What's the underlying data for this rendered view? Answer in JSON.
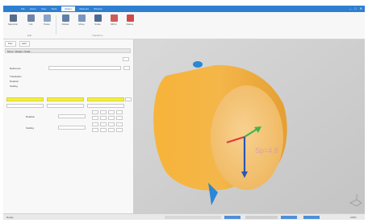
{
  "title_tabs": [
    "File",
    "Home",
    "View",
    "Tools",
    "Model",
    "Measure",
    "Window"
  ],
  "active_tab": "Model",
  "window_controls": {
    "minimize": "–",
    "maximize": "□",
    "close": "✕"
  },
  "ribbon": {
    "buttons": [
      {
        "label": "Selection",
        "color": "#5a6c8c"
      },
      {
        "label": "Cut",
        "color": "#6f84a8"
      },
      {
        "label": "Paste",
        "color": "#8aa4c8"
      },
      {
        "label": "Rotate",
        "color": "#5f7fa8"
      },
      {
        "label": "Move",
        "color": "#7a96be"
      },
      {
        "label": "Scale",
        "color": "#4d6a96"
      },
      {
        "label": "Mirror",
        "color": "#cf5b5b"
      },
      {
        "label": "Delete",
        "color": "#d04a4a"
      }
    ],
    "groups": [
      "Edit",
      "Transform"
    ]
  },
  "panel": {
    "tabs": [
      "Part",
      "Edit"
    ],
    "section_title": "Move / Rotate / Scale",
    "rows": [
      {
        "label": "Reference"
      },
      {
        "label": "Translation"
      },
      {
        "label": "Rotation"
      },
      {
        "label": "Scaling"
      }
    ],
    "sub_labels": [
      "Rotation",
      "Scaling"
    ]
  },
  "viewport": {
    "measure_label": "Sp=4.8",
    "colors": {
      "cylinder": "#f3b53e",
      "cap": "#f6c971",
      "x_axis": "#e03a3a",
      "y_axis": "#46b04a",
      "z_axis": "#2a54b8",
      "marker": "#2b86d6"
    }
  },
  "status": {
    "left": "Ready",
    "right": "100%"
  }
}
